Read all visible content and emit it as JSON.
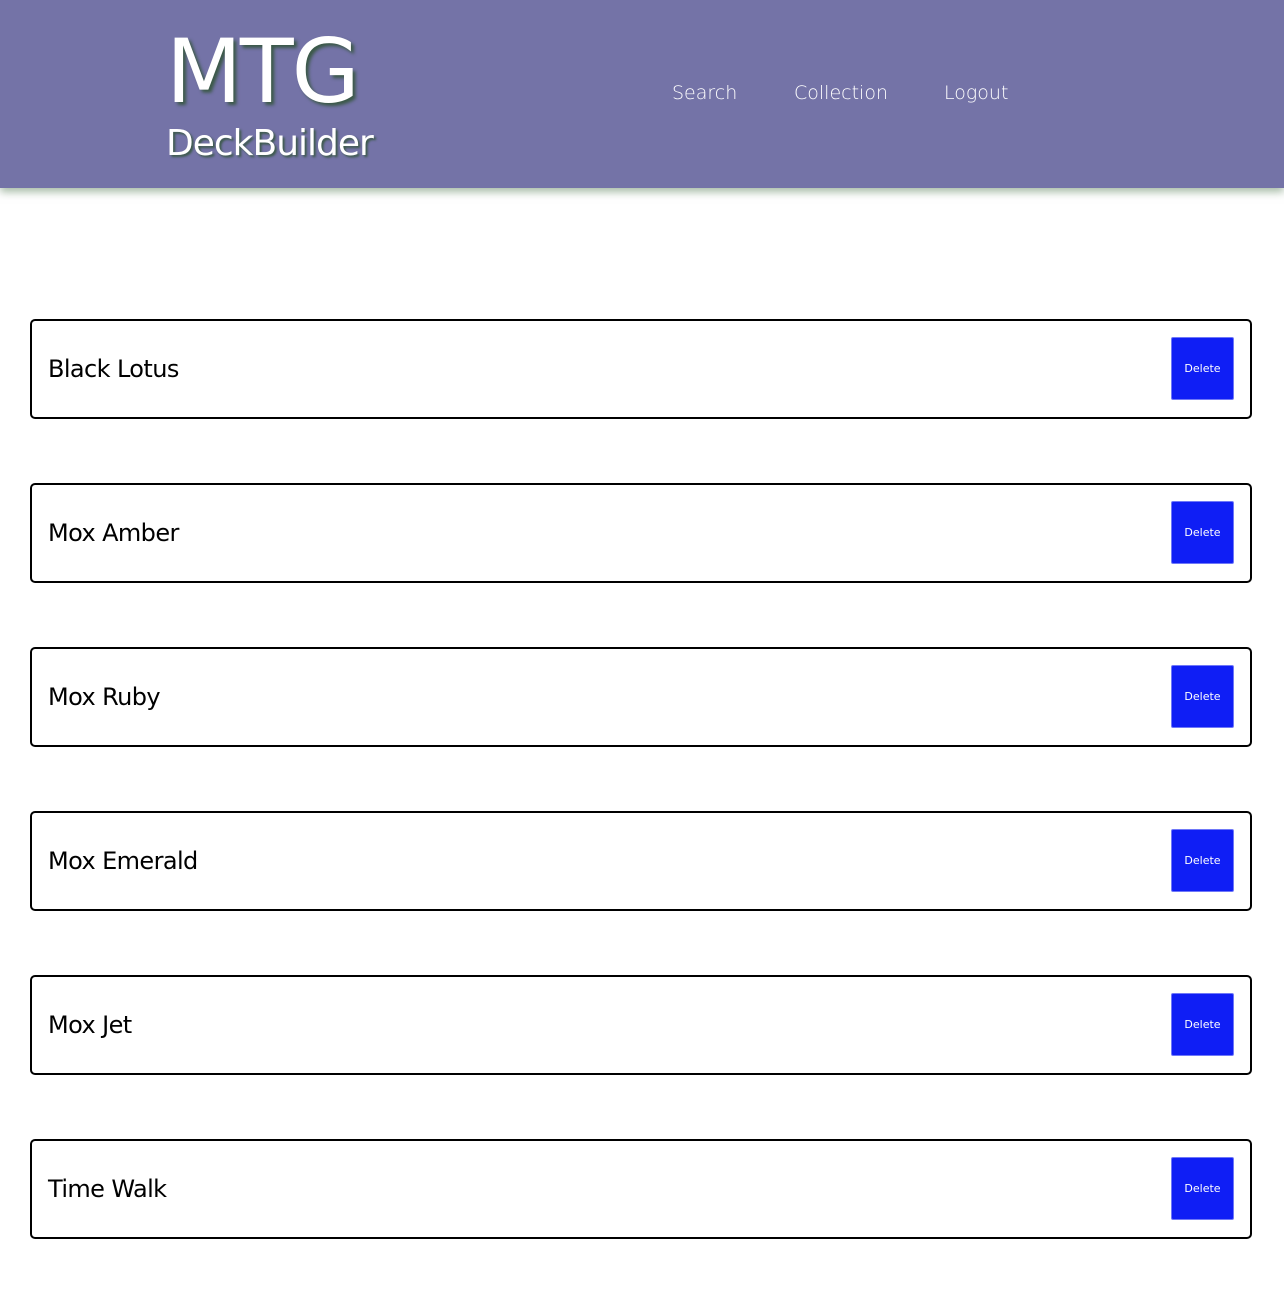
{
  "header": {
    "logo_line1": "MTG",
    "logo_line2": "DeckBuilder",
    "nav": {
      "search": "Search",
      "collection": "Collection",
      "logout": "Logout"
    }
  },
  "cards": [
    {
      "name": "Black Lotus",
      "action": "Delete"
    },
    {
      "name": "Mox Amber",
      "action": "Delete"
    },
    {
      "name": "Mox Ruby",
      "action": "Delete"
    },
    {
      "name": "Mox Emerald",
      "action": "Delete"
    },
    {
      "name": "Mox Jet",
      "action": "Delete"
    },
    {
      "name": "Time Walk",
      "action": "Delete"
    }
  ],
  "colors": {
    "header_bg": "#7473a7",
    "delete_button": "#0f1ef5",
    "card_border": "#000000"
  }
}
